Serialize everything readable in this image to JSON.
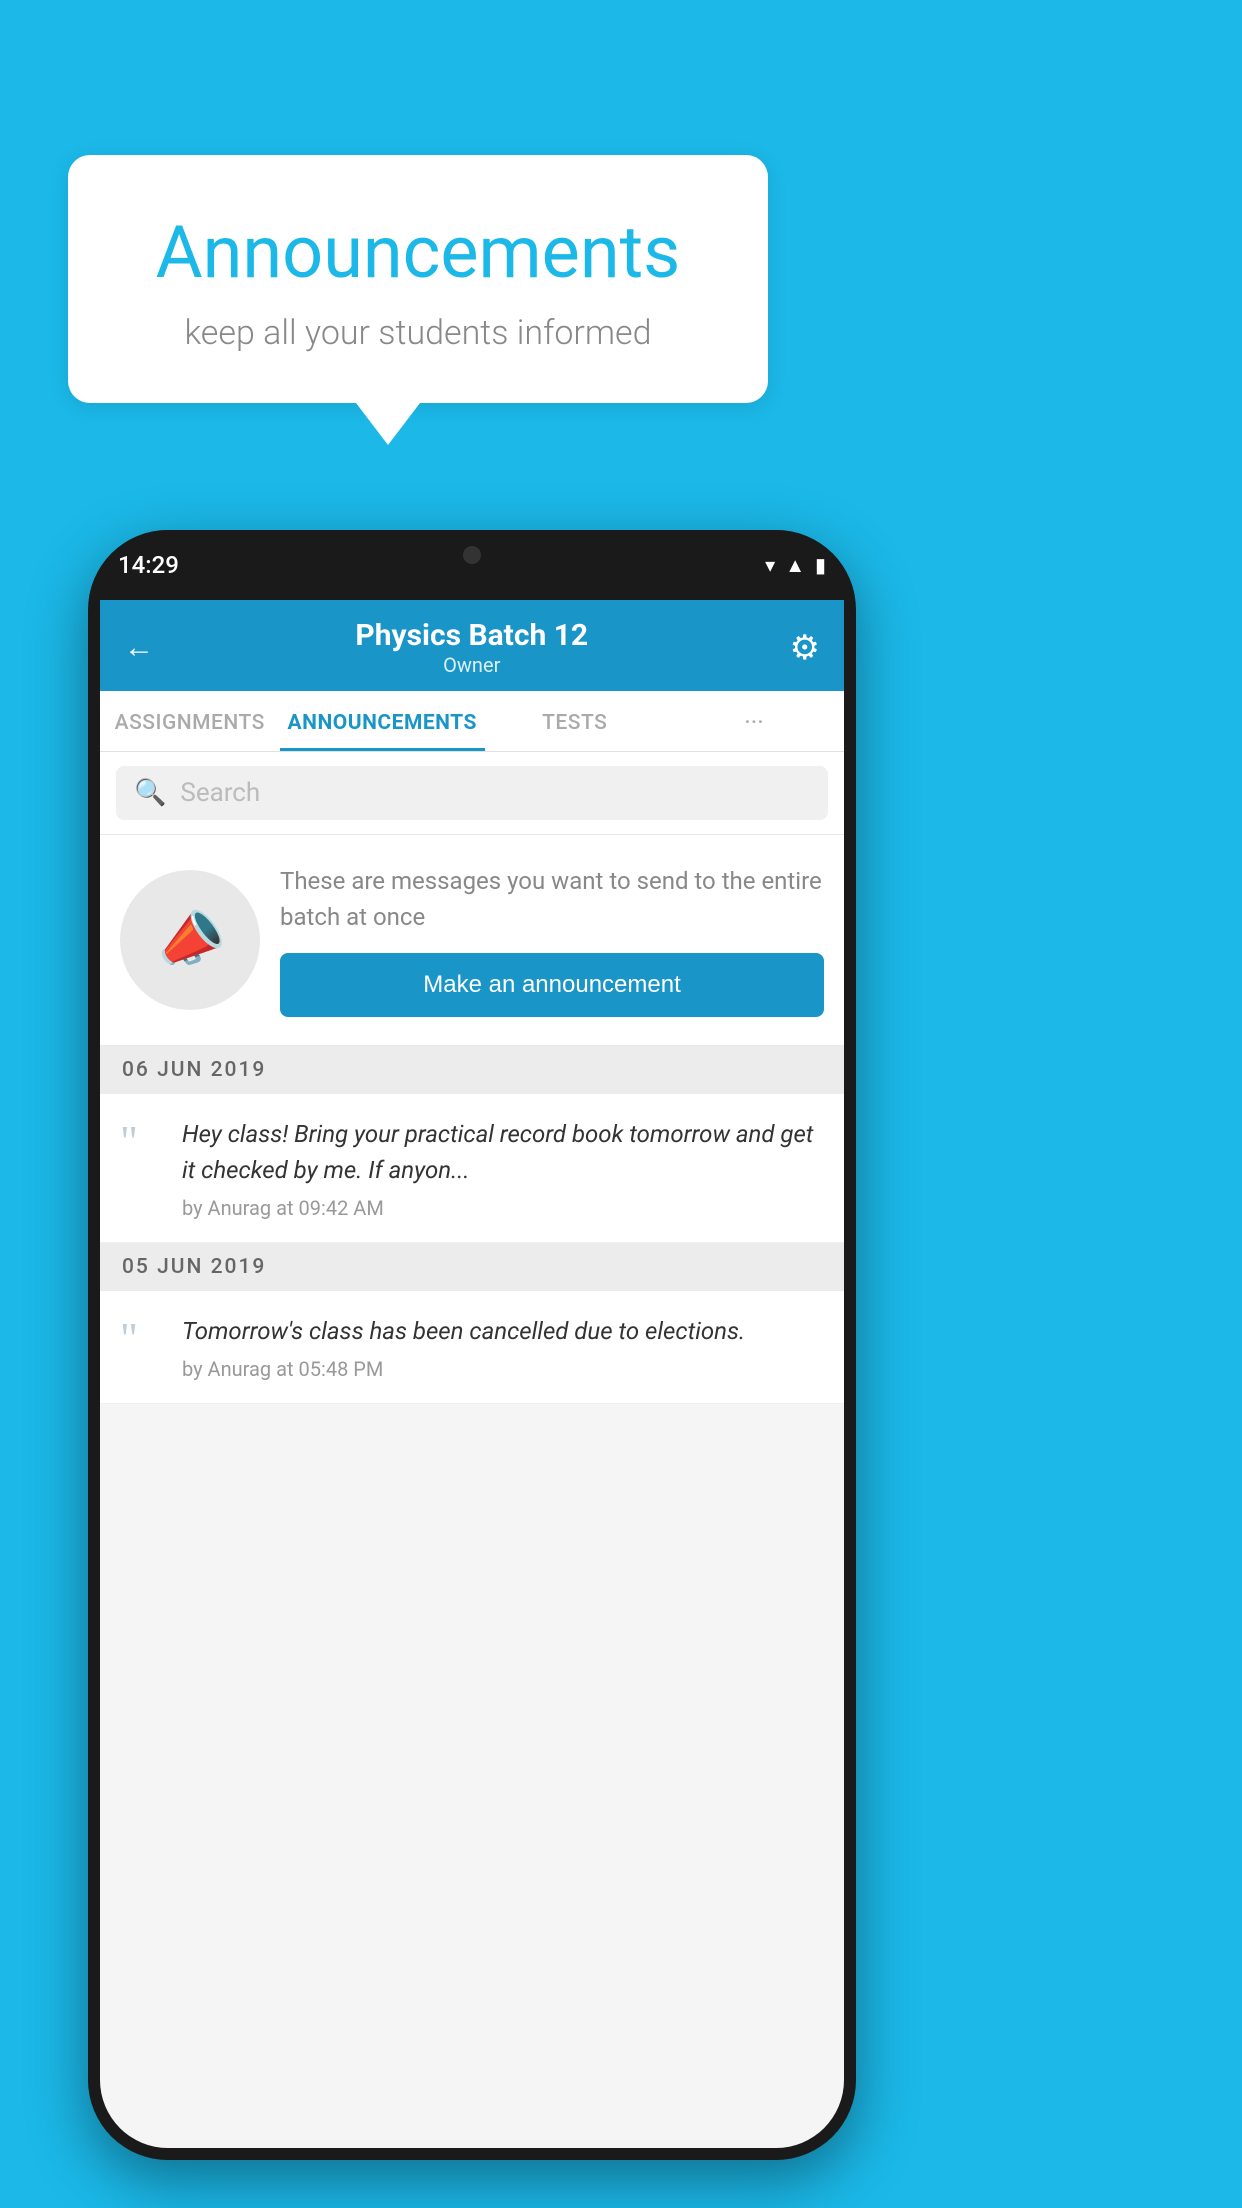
{
  "background_color": "#1BB8E8",
  "speech_bubble": {
    "title": "Announcements",
    "subtitle": "keep all your students informed"
  },
  "phone": {
    "status_bar": {
      "time": "14:29"
    },
    "header": {
      "title": "Physics Batch 12",
      "subtitle": "Owner",
      "back_label": "←",
      "gear_label": "⚙"
    },
    "tabs": [
      {
        "label": "ASSIGNMENTS",
        "active": false
      },
      {
        "label": "ANNOUNCEMENTS",
        "active": true
      },
      {
        "label": "TESTS",
        "active": false
      },
      {
        "label": "···",
        "active": false
      }
    ],
    "search": {
      "placeholder": "Search"
    },
    "promo": {
      "description": "These are messages you want to send to the entire batch at once",
      "button_label": "Make an announcement"
    },
    "announcement_groups": [
      {
        "date": "06  JUN  2019",
        "items": [
          {
            "text": "Hey class! Bring your practical record book tomorrow and get it checked by me. If anyon...",
            "meta": "by Anurag at 09:42 AM"
          }
        ]
      },
      {
        "date": "05  JUN  2019",
        "items": [
          {
            "text": "Tomorrow's class has been cancelled due to elections.",
            "meta": "by Anurag at 05:48 PM"
          }
        ]
      }
    ]
  }
}
